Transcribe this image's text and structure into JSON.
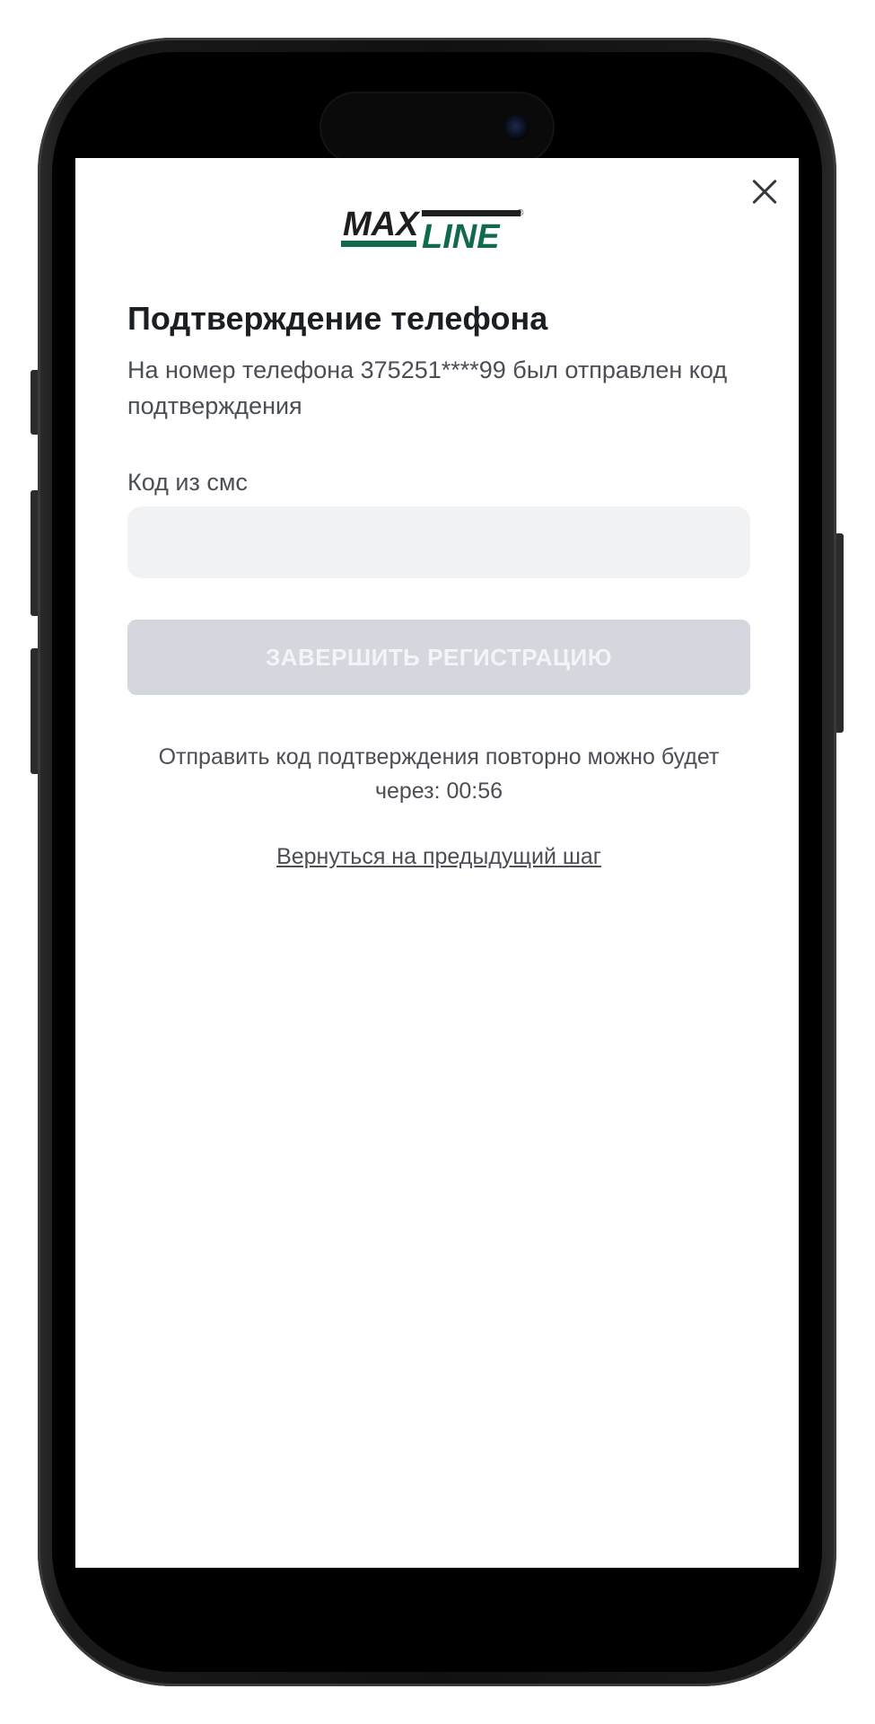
{
  "brand": {
    "logo_part1": "MAX",
    "logo_part2": "LINE",
    "logo_mark": "®",
    "logo_dark_color": "#1e1e1e",
    "logo_green_color": "#0f6b4a"
  },
  "header": {
    "close_icon": "close-icon"
  },
  "page": {
    "title": "Подтверждение телефона",
    "subtitle": "На номер телефона 375251****99 был отправлен код подтверждения"
  },
  "form": {
    "code_label": "Код из смс",
    "code_value": "",
    "code_placeholder": "",
    "submit_label": "ЗАВЕРШИТЬ РЕГИСТРАЦИЮ",
    "submit_disabled_color": "#d4d8de"
  },
  "resend": {
    "text_line1": "Отправить код подтверждения повторно можно будет",
    "text_line2": "через: 00:56"
  },
  "navigation": {
    "back_label": "Вернуться на предыдущий шаг"
  }
}
